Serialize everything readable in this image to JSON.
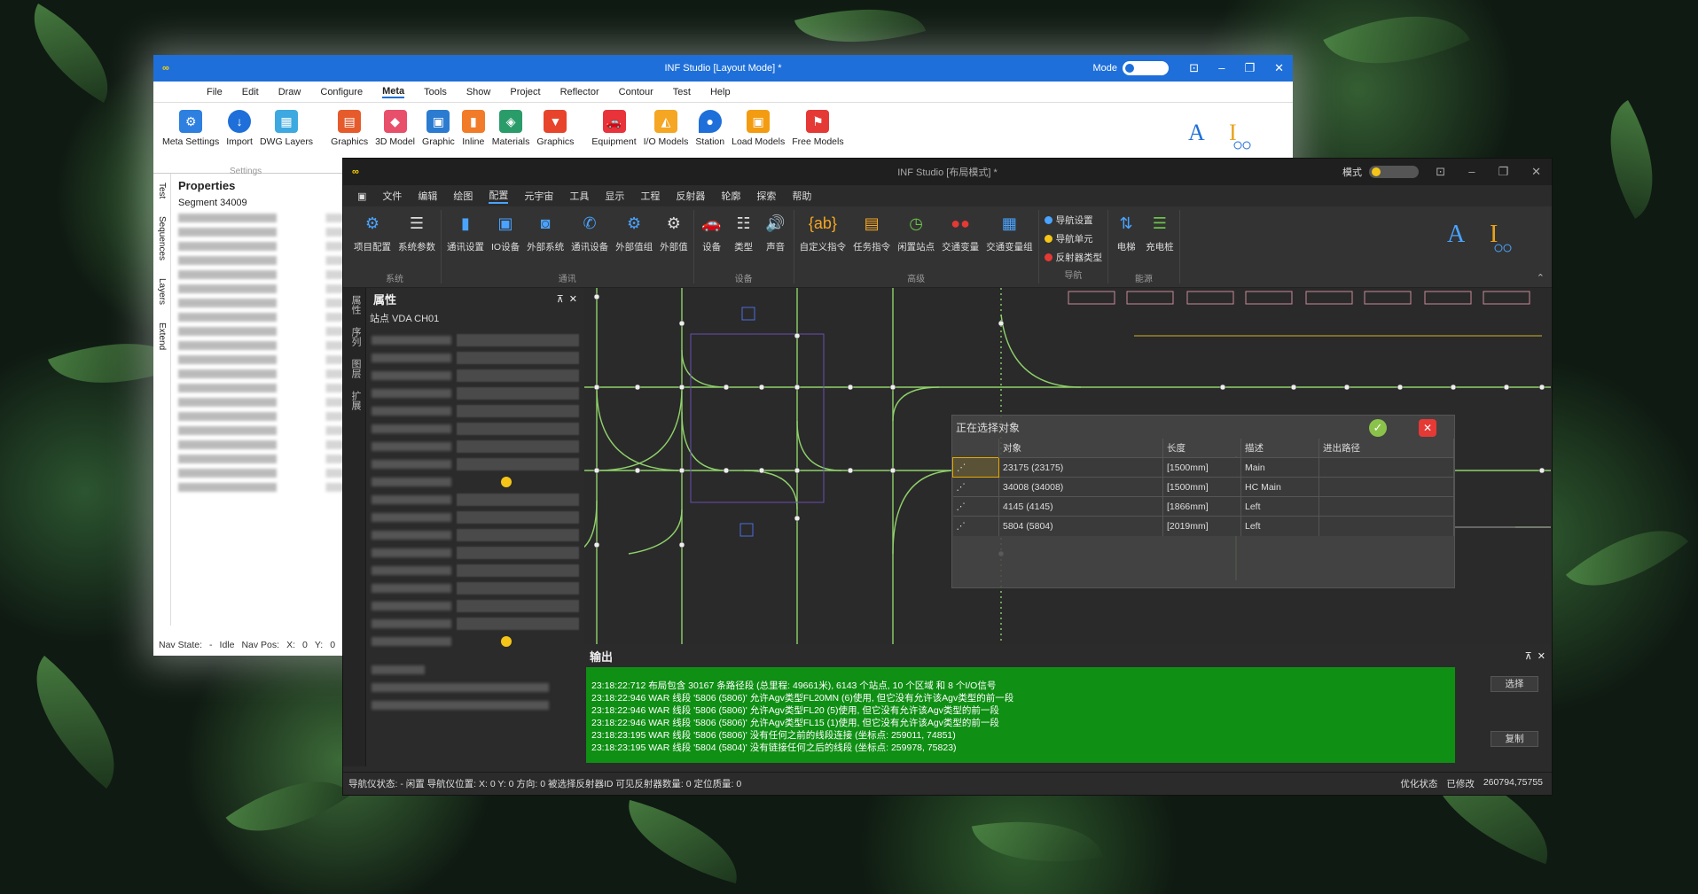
{
  "win_a": {
    "title": "INF Studio [Layout Mode] *",
    "mode_label": "Mode",
    "menu": [
      "File",
      "Edit",
      "Draw",
      "Configure",
      "Meta",
      "Tools",
      "Show",
      "Project",
      "Reflector",
      "Contour",
      "Test",
      "Help"
    ],
    "ribbon": [
      "Meta Settings",
      "Import",
      "DWG Layers",
      "Graphics",
      "3D Model",
      "Graphic",
      "Inline",
      "Materials",
      "Graphics",
      "Equipment",
      "I/O Models",
      "Station",
      "Load Models",
      "Free Models"
    ],
    "ribbon_group": "Settings",
    "side_tabs": [
      "Test",
      "Sequences",
      "Layers",
      "Extend"
    ],
    "properties_title": "Properties",
    "segment": "Segment 34009",
    "status": [
      "Nav State:",
      "-",
      "Idle",
      "Nav Pos:",
      "X:",
      "0",
      "Y:",
      "0"
    ]
  },
  "win_b": {
    "title": "INF Studio [布局模式] *",
    "mode_label": "模式",
    "menu": [
      "文件",
      "编辑",
      "绘图",
      "配置",
      "元宇宙",
      "工具",
      "显示",
      "工程",
      "反射器",
      "轮廓",
      "探索",
      "帮助"
    ],
    "groups": [
      {
        "label": "系统",
        "items": [
          "项目配置",
          "系统参数"
        ]
      },
      {
        "label": "通讯",
        "items": [
          "通讯设置",
          "IO设备",
          "外部系统",
          "通讯设备",
          "外部值组",
          "外部值"
        ]
      },
      {
        "label": "设备",
        "items": [
          "设备",
          "类型",
          "声音"
        ]
      },
      {
        "label": "高级",
        "items": [
          "自定义指令",
          "任务指令",
          "闲置站点",
          "交通变量",
          "交通变量组"
        ]
      },
      {
        "label": "导航",
        "items": [
          "导航设置",
          "导航单元",
          "反射器类型"
        ]
      },
      {
        "label": "能源",
        "items": [
          "电梯",
          "充电桩"
        ]
      }
    ],
    "vtabs": [
      "属性",
      "序列",
      "图层",
      "扩展"
    ],
    "props_title": "属性",
    "props_sub": "站点 VDA CH01",
    "dialog": {
      "title": "正在选择对象",
      "headers": [
        "对象",
        "长度",
        "描述",
        "进出路径"
      ],
      "rows": [
        [
          "23175 (23175)",
          "[1500mm]",
          "Main",
          ""
        ],
        [
          "34008 (34008)",
          "[1500mm]",
          "HC Main",
          ""
        ],
        [
          "4145 (4145)",
          "[1866mm]",
          "Left",
          ""
        ],
        [
          "5804 (5804)",
          "[2019mm]",
          "Left",
          ""
        ]
      ]
    },
    "output_title": "输出",
    "log": [
      "23:18:22:712    布局包含 30167 条路径段 (总里程: 49661米), 6143 个站点, 10 个区域 和 8 个I/O信号",
      "23:18:22:946 WAR  线段 '5806 (5806)' 允许Agv类型FL20MN (6)使用, 但它没有允许该Agv类型的前一段",
      "23:18:22:946 WAR  线段 '5806 (5806)' 允许Agv类型FL20 (5)使用, 但它没有允许该Agv类型的前一段",
      "23:18:22:946 WAR  线段 '5806 (5806)' 允许Agv类型FL15 (1)使用, 但它没有允许该Agv类型的前一段",
      "23:18:23:195 WAR  线段 '5806 (5806)' 没有任何之前的线段连接 (坐标点: 259011, 74851)",
      "23:18:23:195 WAR  线段 '5804 (5804)' 没有链接任何之后的线段 (坐标点: 259978, 75823)"
    ],
    "btn_select": "选择",
    "btn_copy": "复制",
    "status": {
      "left": "导航仪状态: - 闲置  导航仪位置: X: 0  Y: 0  方向: 0  被选择反射器ID  可见反射器数量: 0  定位质量: 0",
      "opt": "优化状态",
      "modified": "已修改",
      "coords": "260794,75755"
    }
  },
  "colors": {
    "accent_blue": "#1e6fd9",
    "log_green": "#0f8f14",
    "track": "#8fd16a"
  }
}
